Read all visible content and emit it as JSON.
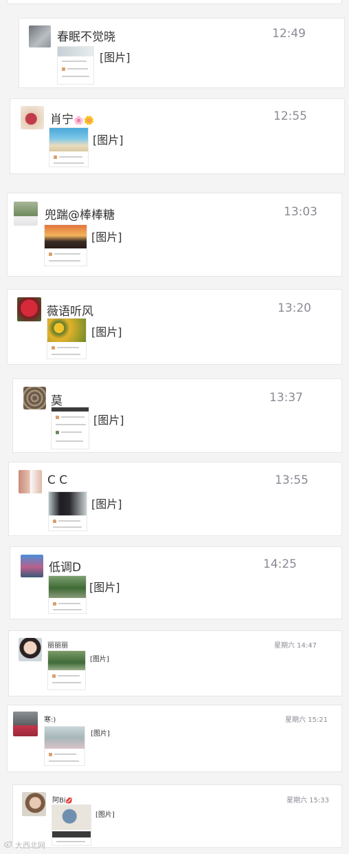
{
  "messages": [
    {
      "name": "春眠不觉晓",
      "time": "12:49",
      "preview": "[图片]"
    },
    {
      "name": "肖宁",
      "emoji": "🌸🌼",
      "time": "12:55",
      "preview": "[图片]"
    },
    {
      "name": "兜踹@棒棒糖",
      "time": "13:03",
      "preview": "[图片]"
    },
    {
      "name": "薇语听风",
      "time": "13:20",
      "preview": "[图片]"
    },
    {
      "name": "莫",
      "time": "13:37",
      "preview": "[图片]"
    },
    {
      "name": "C C",
      "time": "13:55",
      "preview": "[图片]"
    },
    {
      "name": "低调D",
      "time": "14:25",
      "preview": "[图片]"
    },
    {
      "name": "丽丽丽",
      "time": "星期六 14:47",
      "preview": "[图片]"
    },
    {
      "name": "寒:)",
      "time": "星期六 15:21",
      "preview": "[图片]"
    },
    {
      "name": "阿Bi",
      "emoji": "💋",
      "time": "星期六 15:33",
      "preview": "[图片]"
    }
  ],
  "watermark": "大西北网",
  "colors": {
    "page_bg": "#f4f4f4",
    "card_bg": "#ffffff",
    "time": "#8a8a95"
  }
}
